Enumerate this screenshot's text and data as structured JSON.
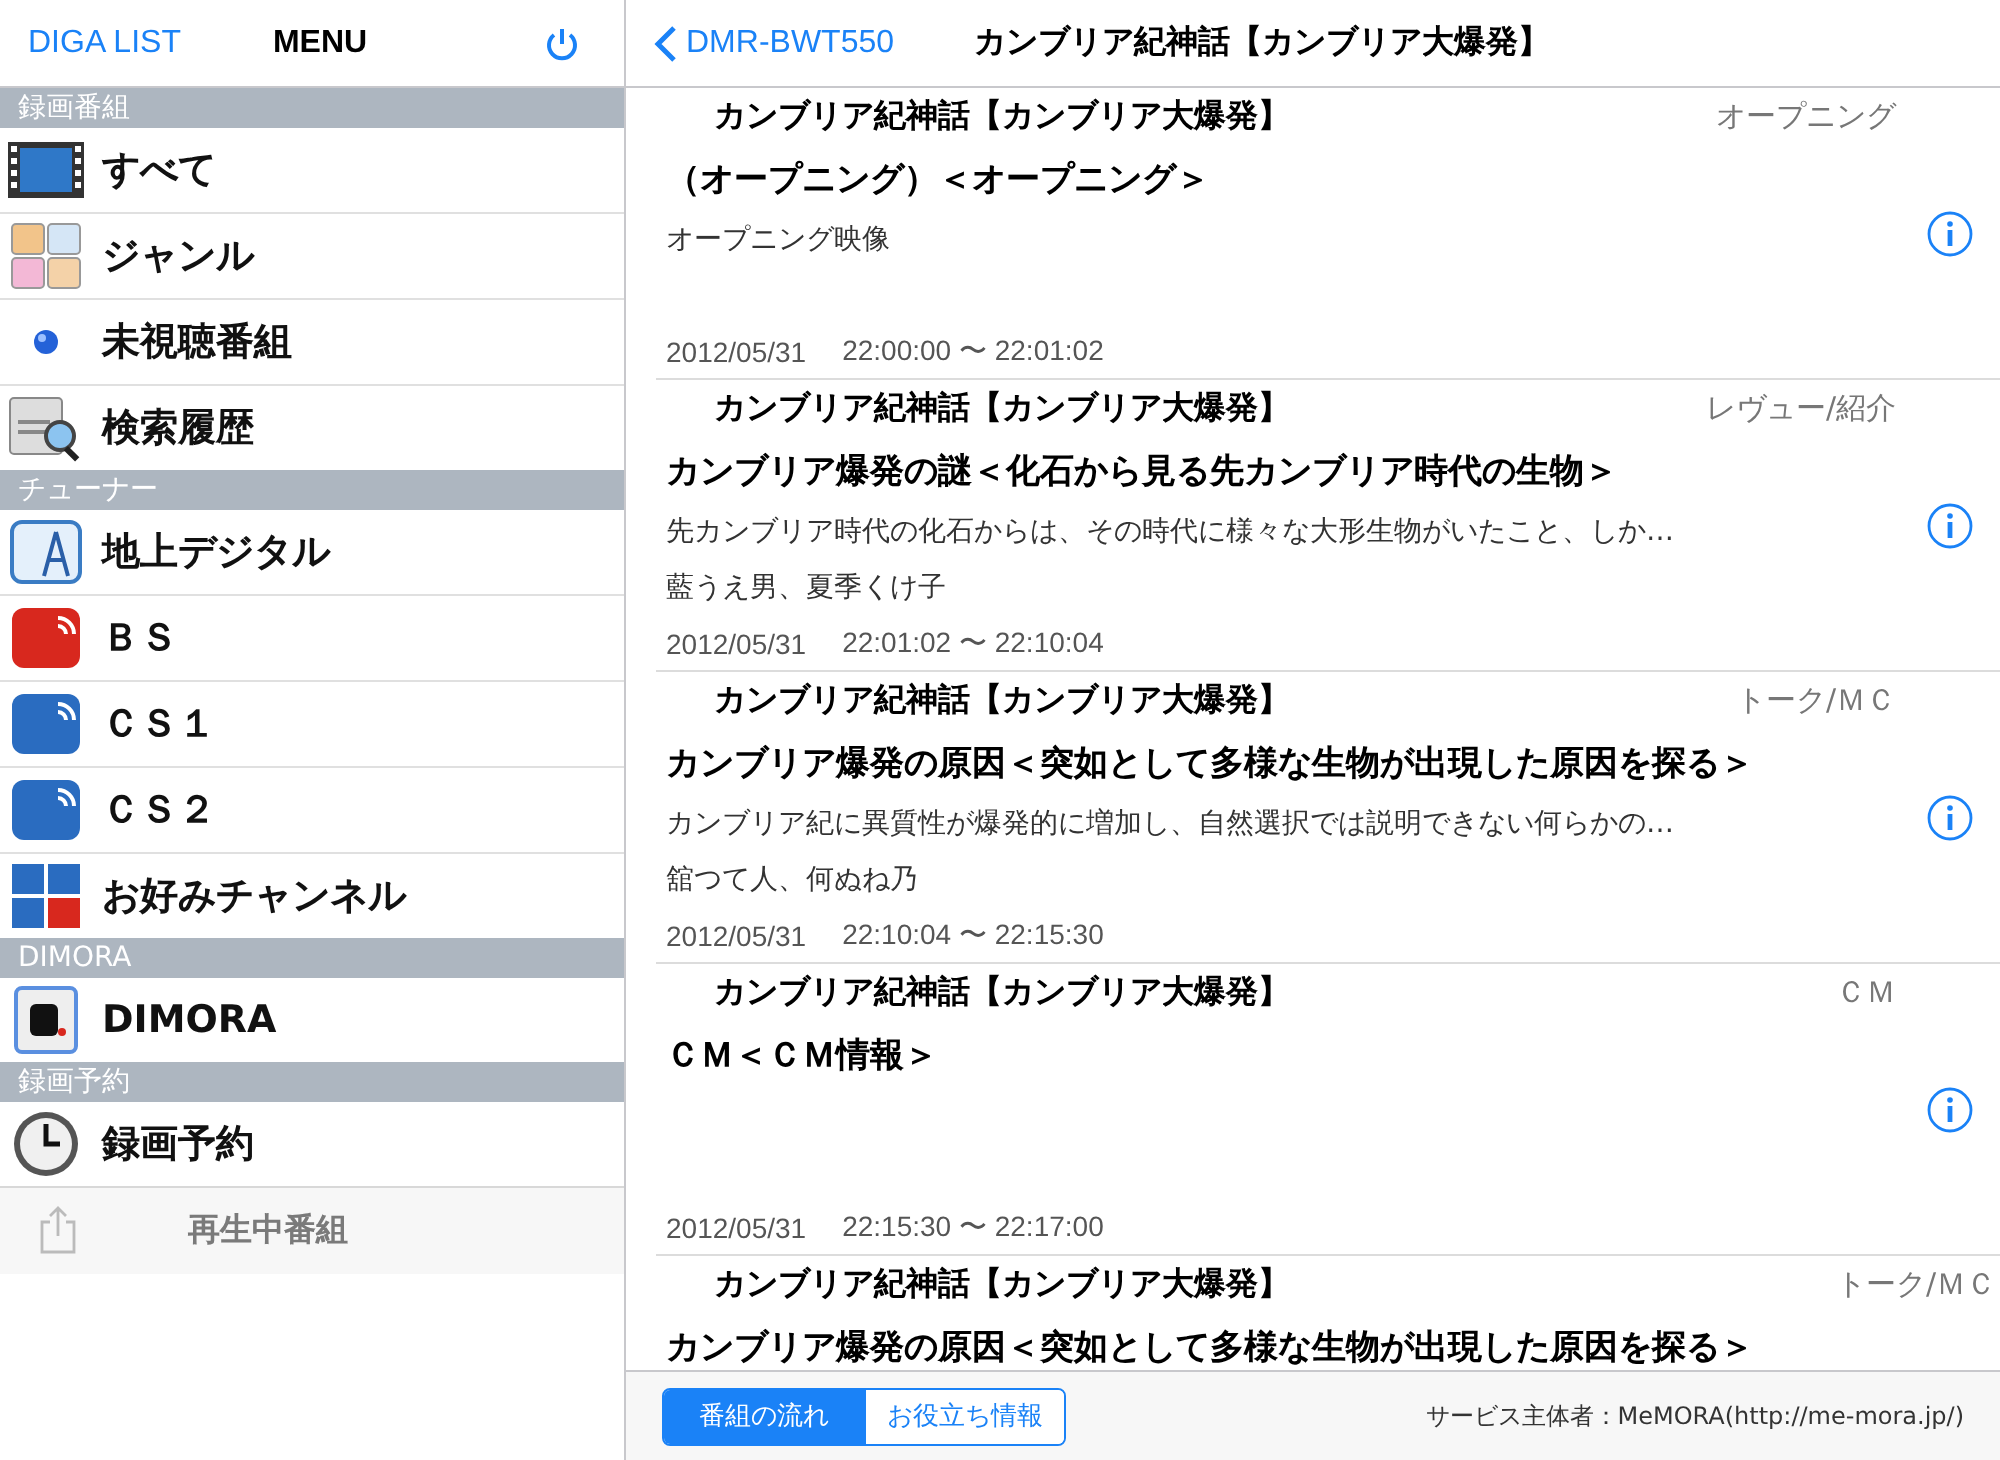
{
  "sidebar": {
    "back_label": "DIGA LIST",
    "title": "MENU",
    "sections": [
      {
        "header": "録画番組",
        "items": [
          {
            "label": "すべて"
          },
          {
            "label": "ジャンル"
          },
          {
            "label": "未視聴番組"
          },
          {
            "label": "検索履歴"
          }
        ]
      },
      {
        "header": "チューナー",
        "items": [
          {
            "label": "地上デジタル"
          },
          {
            "label": "ＢＳ"
          },
          {
            "label": "ＣＳ１"
          },
          {
            "label": "ＣＳ２"
          },
          {
            "label": "お好みチャンネル"
          }
        ]
      },
      {
        "header": "DIMORA",
        "items": [
          {
            "label": "DIMORA"
          }
        ]
      },
      {
        "header": "録画予約",
        "items": [
          {
            "label": "録画予約"
          }
        ]
      }
    ],
    "footer": "再生中番組"
  },
  "nav": {
    "back_label": "DMR-BWT550",
    "title": "カンブリア紀神話【カンブリア大爆発】"
  },
  "entries": [
    {
      "title": "カンブリア紀神話【カンブリア大爆発】",
      "genre": "オープニング",
      "program": "（オープニング）＜オープニング＞",
      "description": "オープニング映像",
      "date": "2012/05/31",
      "time": "22:00:00 〜 22:01:02"
    },
    {
      "title": "カンブリア紀神話【カンブリア大爆発】",
      "genre": "レヴュー/紹介",
      "program": "カンブリア爆発の謎＜化石から見る先カンブリア時代の生物＞",
      "description": "先カンブリア時代の化石からは、その時代に様々な大形生物がいたこと、しか…",
      "cast": "藍うえ男、夏季くけ子",
      "date": "2012/05/31",
      "time": "22:01:02 〜 22:10:04"
    },
    {
      "title": "カンブリア紀神話【カンブリア大爆発】",
      "genre": "トーク/ＭＣ",
      "program": "カンブリア爆発の原因＜突如として多様な生物が出現した原因を探る＞",
      "description": "カンブリア紀に異質性が爆発的に増加し、自然選択では説明できない何らかの…",
      "cast": "舘つて人、何ぬね乃",
      "date": "2012/05/31",
      "time": "22:10:04 〜 22:15:30"
    },
    {
      "title": "カンブリア紀神話【カンブリア大爆発】",
      "genre": "ＣＭ",
      "program": "ＣＭ＜ＣＭ情報＞",
      "date": "2012/05/31",
      "time": "22:15:30 〜 22:17:00"
    },
    {
      "title": "カンブリア紀神話【カンブリア大爆発】",
      "genre": "トーク/ＭＣ",
      "program": "カンブリア爆発の原因＜突如として多様な生物が出現した原因を探る＞"
    }
  ],
  "bottom_bar": {
    "tabs": [
      {
        "label": "番組の流れ",
        "selected": true
      },
      {
        "label": "お役立ち情報",
        "selected": false
      }
    ],
    "credit": "サービス主体者：MeMORA(http://me-mora.jp/)"
  }
}
